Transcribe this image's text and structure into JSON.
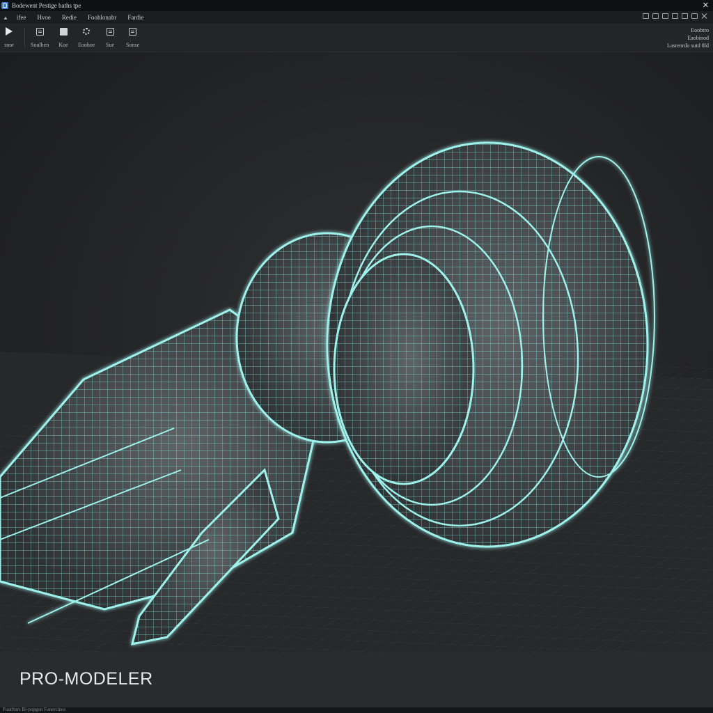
{
  "window": {
    "title": "Bodewent Pestige baths tpe"
  },
  "menubar": {
    "items": [
      {
        "label": "ifee"
      },
      {
        "label": "Hvoe"
      },
      {
        "label": "Redie"
      },
      {
        "label": "Foohlonabr"
      },
      {
        "label": "Fardie"
      }
    ]
  },
  "toolbar": {
    "tools": [
      {
        "label": "snor",
        "icon": "play-icon"
      },
      {
        "label": "Soulhen",
        "icon": "panel-icon"
      },
      {
        "label": "Koe",
        "icon": "cube-icon"
      },
      {
        "label": "Eoohoe",
        "icon": "gear-icon"
      },
      {
        "label": "Sue",
        "icon": "edit-icon"
      },
      {
        "label": "Sonse",
        "icon": "image-icon"
      }
    ],
    "right": {
      "line1": "Eoobtro",
      "line2": "Eaobinod",
      "line3": "Lasrenrdo sutd 8ld"
    }
  },
  "brand": {
    "label": "PRO-MODELER"
  },
  "status": {
    "text": "Foutfturs Bi-popgon Fonercinos"
  },
  "colors": {
    "wire": "#7ee6e0",
    "wire_dim": "#4fb3ad",
    "background": "#1b1c1d"
  }
}
